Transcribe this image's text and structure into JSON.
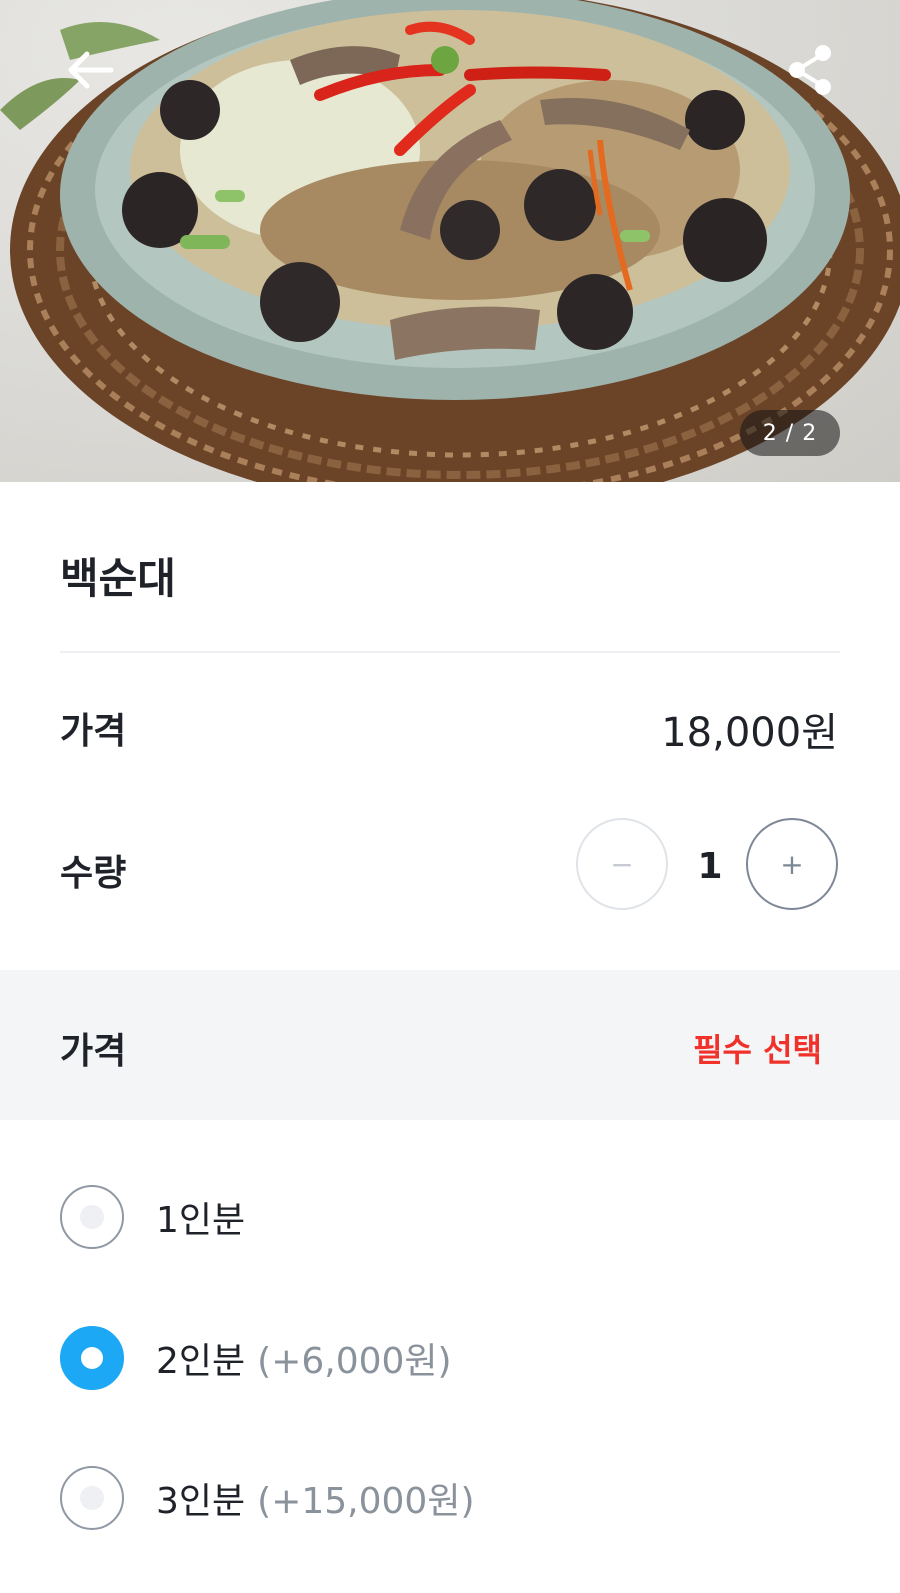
{
  "gallery": {
    "counter": "2 / 2"
  },
  "menu": {
    "name": "백순대"
  },
  "price": {
    "label": "가격",
    "value": "18,000원"
  },
  "quantity": {
    "label": "수량",
    "minus": "−",
    "value": "1",
    "plus": "+"
  },
  "options": {
    "title": "가격",
    "required": "필수 선택",
    "items": [
      {
        "name": "1인분",
        "extra": "",
        "selected": false
      },
      {
        "name": "2인분",
        "extra": "(+6,000원)",
        "selected": true
      },
      {
        "name": "3인분",
        "extra": "(+15,000원)",
        "selected": false
      }
    ]
  },
  "colors": {
    "accent": "#1ca8f5",
    "required": "#f0322b"
  }
}
